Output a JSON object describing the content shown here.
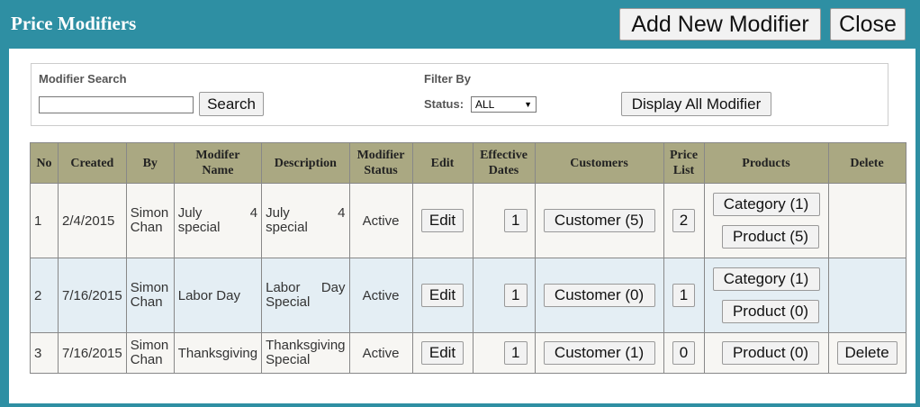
{
  "header": {
    "title": "Price Modifiers",
    "add_button": "Add New Modifier",
    "close_button": "Close"
  },
  "search": {
    "modifier_search_label": "Modifier Search",
    "search_value": "",
    "search_button": "Search",
    "filter_by_label": "Filter By",
    "status_label": "Status:",
    "status_selected": "ALL",
    "display_all_button": "Display All Modifier"
  },
  "table": {
    "headers": {
      "no": "No",
      "created": "Created",
      "by": "By",
      "name": "Modifer Name",
      "description": "Description",
      "status": "Modifier Status",
      "edit": "Edit",
      "effective": "Effective Dates",
      "customers": "Customers",
      "price_list": "Price List",
      "products": "Products",
      "delete": "Delete"
    },
    "rows": [
      {
        "no": "1",
        "created": "2/4/2015",
        "by": "Simon Chan",
        "name_a": "July",
        "name_b": "4",
        "name_c": "special",
        "desc_a": "July",
        "desc_b": "4",
        "desc_c": "special",
        "status": "Active",
        "edit": "Edit",
        "effective": "1",
        "customers": "Customer (5)",
        "price_list": "2",
        "category": "Category (1)",
        "product": "Product (5)"
      },
      {
        "no": "2",
        "created": "7/16/2015",
        "by": "Simon Chan",
        "name": "Labor Day",
        "desc_a": "Labor",
        "desc_b": "Day",
        "desc_c": "Special",
        "status": "Active",
        "edit": "Edit",
        "effective": "1",
        "customers": "Customer (0)",
        "price_list": "1",
        "category": "Category (1)",
        "product": "Product (0)"
      },
      {
        "no": "3",
        "created": "7/16/2015",
        "by": "Simon Chan",
        "name": "Thanksgiving",
        "desc_a": "Thanksgiving",
        "desc_c": "Special",
        "status": "Active",
        "edit": "Edit",
        "effective": "1",
        "customers": "Customer (1)",
        "price_list": "0",
        "product": "Product (0)",
        "delete": "Delete"
      }
    ]
  }
}
